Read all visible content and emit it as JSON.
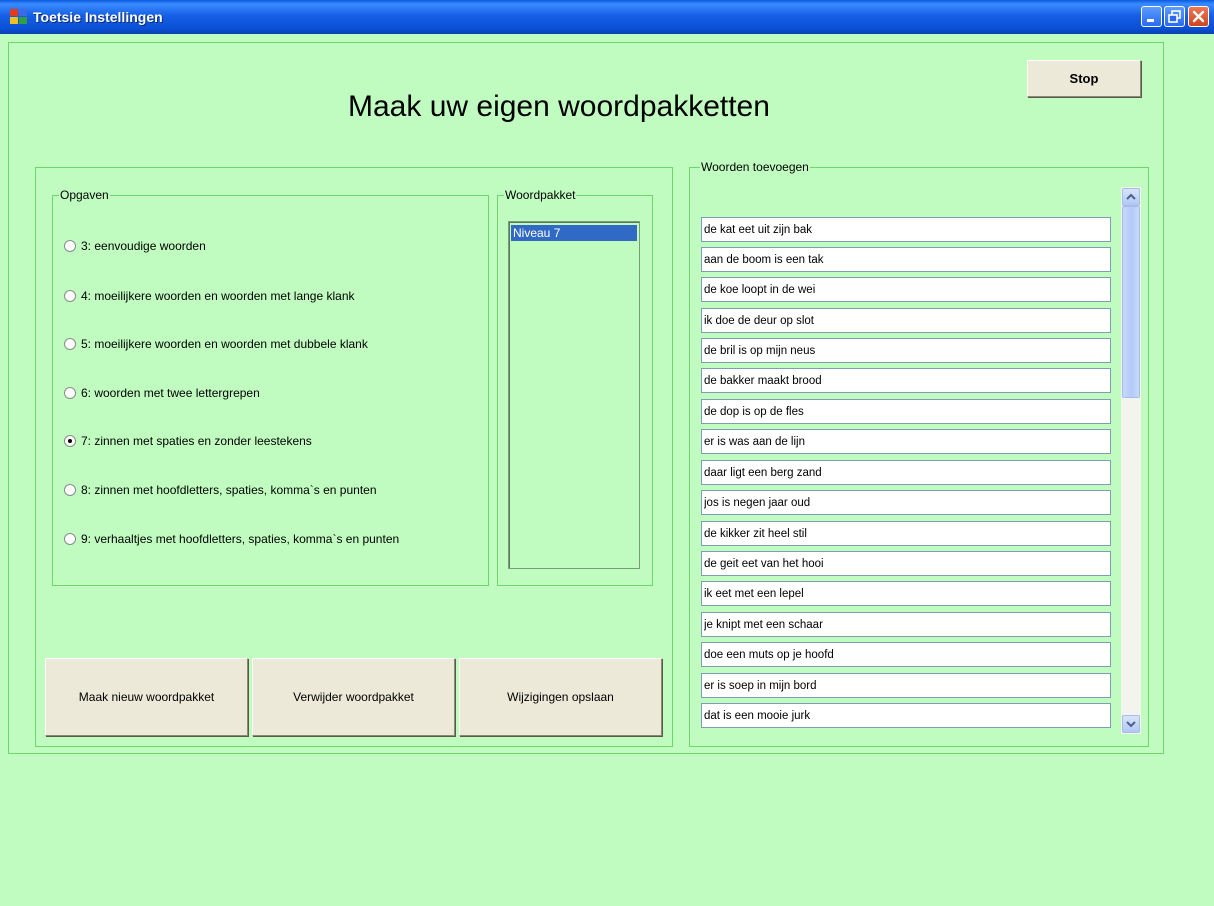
{
  "window": {
    "title": "Toetsie Instellingen"
  },
  "header": {
    "heading": "Maak uw eigen woordpakketten",
    "stop_label": "Stop"
  },
  "opgaven": {
    "legend": "Opgaven",
    "options": [
      {
        "label": "3: eenvoudige woorden",
        "checked": false
      },
      {
        "label": "4: moeilijkere woorden en woorden met lange klank",
        "checked": false
      },
      {
        "label": "5: moeilijkere woorden en woorden met dubbele klank",
        "checked": false
      },
      {
        "label": "6: woorden met twee lettergrepen",
        "checked": false
      },
      {
        "label": "7: zinnen met spaties en zonder leestekens",
        "checked": true
      },
      {
        "label": "8: zinnen met hoofdletters, spaties, komma`s en punten",
        "checked": false
      },
      {
        "label": "9: verhaaltjes met hoofdletters, spaties, komma`s en punten",
        "checked": false
      }
    ]
  },
  "woordpakket": {
    "legend": "Woordpakket",
    "items": [
      "Niveau 7"
    ],
    "selected": "Niveau 7"
  },
  "actions": {
    "new_label": "Maak nieuw woordpakket",
    "delete_label": "Verwijder woordpakket",
    "save_label": "Wijzigingen opslaan"
  },
  "woorden": {
    "legend": "Woorden toevoegen",
    "items": [
      "de kat eet uit zijn bak",
      "aan de boom is een tak",
      "de koe loopt in de wei",
      "ik doe de deur op slot",
      "de bril is op mijn neus",
      "de bakker maakt brood",
      "de dop is op de fles",
      "er is was aan de lijn",
      "daar ligt een berg zand",
      "jos is negen jaar oud",
      "de kikker zit heel stil",
      "de geit eet van het hooi",
      "ik eet met een lepel",
      "je knipt met een schaar",
      "doe een muts op je hoofd",
      "er is soep in mijn bord",
      "dat is een mooie jurk"
    ]
  },
  "colors": {
    "background": "#c0fcc0",
    "titlebar": "#0a4fd4",
    "selection": "#316ac5",
    "frame": "#6cd86c"
  },
  "icons": [
    "app-icon",
    "minimize-icon",
    "maximize-icon",
    "close-icon",
    "scroll-up-icon",
    "scroll-down-icon"
  ]
}
